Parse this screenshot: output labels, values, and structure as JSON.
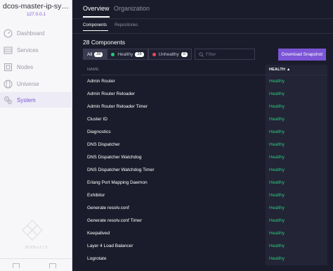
{
  "sidebar": {
    "cluster_name": "dcos-master-ip-sysops...",
    "cluster_ip": "127.0.0.1",
    "items": [
      {
        "label": "Dashboard",
        "icon": "dashboard-icon"
      },
      {
        "label": "Services",
        "icon": "services-icon"
      },
      {
        "label": "Nodes",
        "icon": "nodes-icon"
      },
      {
        "label": "Universe",
        "icon": "universe-icon"
      },
      {
        "label": "System",
        "icon": "system-icon",
        "active": true
      }
    ],
    "version": "DC/OS v.1.7.0"
  },
  "header": {
    "tabs": [
      {
        "label": "Overview",
        "active": true
      },
      {
        "label": "Organization"
      }
    ],
    "subtabs": [
      {
        "label": "Components",
        "active": true
      },
      {
        "label": "Repositories"
      }
    ]
  },
  "main": {
    "count_title": "28 Components",
    "filters": {
      "all_label": "All",
      "all_count": "28",
      "healthy_label": "Healthy",
      "healthy_count": "28",
      "unhealthy_label": "Unhealthy",
      "unhealthy_count": "0"
    },
    "filter_placeholder": "Filter",
    "download_label": "Download Snapshot",
    "table": {
      "columns": [
        "NAME",
        "HEALTH ▲"
      ],
      "rows": [
        {
          "name": "Admin Router",
          "health": "Healthy"
        },
        {
          "name": "Admin Router Reloader",
          "health": "Healthy"
        },
        {
          "name": "Admin Router Reloader Timer",
          "health": "Healthy"
        },
        {
          "name": "Cluster ID",
          "health": "Healthy"
        },
        {
          "name": "Diagnostics",
          "health": "Healthy"
        },
        {
          "name": "DNS Dispatcher",
          "health": "Healthy"
        },
        {
          "name": "DNS Dispatcher Watchdog",
          "health": "Healthy"
        },
        {
          "name": "DNS Dispatcher Watchdog Timer",
          "health": "Healthy"
        },
        {
          "name": "Erlang Port Mapping Daemon",
          "health": "Healthy"
        },
        {
          "name": "Exhibitor",
          "health": "Healthy"
        },
        {
          "name": "Generate resolv.conf",
          "health": "Healthy"
        },
        {
          "name": "Generate resolv.conf Timer",
          "health": "Healthy"
        },
        {
          "name": "Keepalived",
          "health": "Healthy"
        },
        {
          "name": "Layer 4 Load Balancer",
          "health": "Healthy"
        },
        {
          "name": "Logrotate",
          "health": "Healthy"
        }
      ]
    }
  },
  "colors": {
    "accent": "#7b55d6",
    "healthy": "#27c97b",
    "background": "#1b1c2b"
  }
}
